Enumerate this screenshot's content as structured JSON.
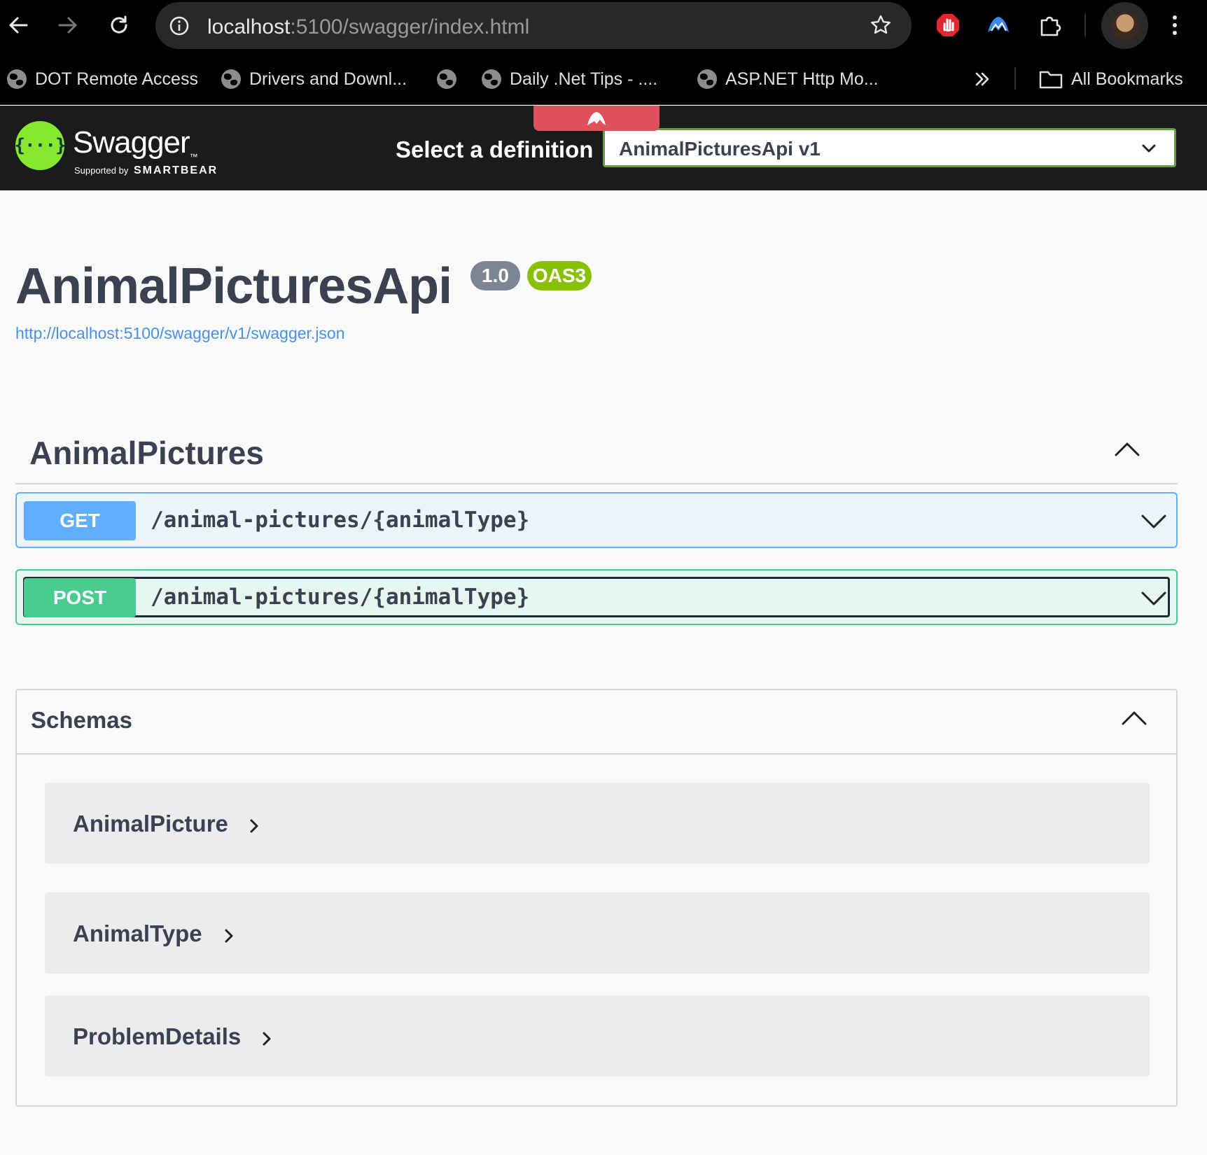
{
  "browser": {
    "url_host": "localhost",
    "url_path": ":5100/swagger/index.html",
    "bookmarks": [
      {
        "label": "DOT Remote Access"
      },
      {
        "label": "Drivers and Downl..."
      },
      {
        "label": ""
      },
      {
        "label": "Daily .Net Tips - ...."
      },
      {
        "label": "ASP.NET Http Mo..."
      }
    ],
    "all_bookmarks": "All Bookmarks"
  },
  "topbar": {
    "logo_symbol": "{···}",
    "logo_text": "Swagger",
    "supported_by": "Supported by",
    "smartbear": "SMARTBEAR",
    "select_label": "Select a definition",
    "selected_definition": "AnimalPicturesApi v1"
  },
  "info": {
    "title": "AnimalPicturesApi",
    "version": "1.0",
    "oas_badge": "OAS3",
    "spec_url": "http://localhost:5100/swagger/v1/swagger.json"
  },
  "tag": {
    "name": "AnimalPictures"
  },
  "operations": [
    {
      "method": "GET",
      "path": "/animal-pictures/{animalType}",
      "color": "#61affe"
    },
    {
      "method": "POST",
      "path": "/animal-pictures/{animalType}",
      "color": "#49cc90"
    }
  ],
  "schemas": {
    "title": "Schemas",
    "models": [
      {
        "name": "AnimalPicture"
      },
      {
        "name": "AnimalType"
      },
      {
        "name": "ProblemDetails"
      }
    ]
  },
  "colors": {
    "get": "#61affe",
    "post": "#49cc90",
    "swagger_green": "#85ea2d",
    "version_badge": "#7d8492",
    "oas_badge": "#89bf04",
    "link": "#4990e2"
  }
}
